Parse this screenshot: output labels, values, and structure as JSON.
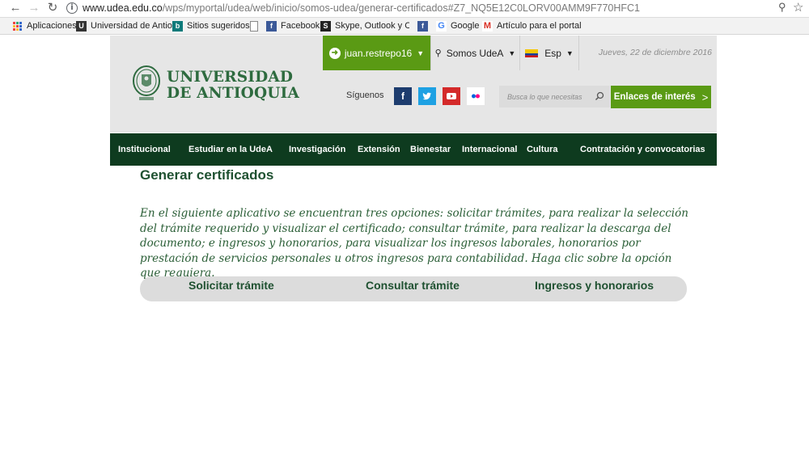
{
  "browser": {
    "url_domain": "www.udea.edu.co",
    "url_path": "/wps/myportal/udea/web/inicio/somos-udea/generar-certificados#Z7_NQ5E12C0LORV00AMM9F770HFC1",
    "bookmarks": [
      "Aplicaciones",
      "Universidad de Antioc",
      "Sitios sugeridos",
      "",
      "Facebook",
      "Skype, Outlook y Cale",
      "",
      "Google",
      "Artículo para el portal"
    ]
  },
  "header": {
    "logo_line1": "UNIVERSIDAD",
    "logo_line2": "DE ANTIOQUIA",
    "user_label": "juan.restrepo16",
    "somos_label": "Somos UdeA",
    "lang_label": "Esp",
    "date_text": "Jueves, 22 de diciembre 2016",
    "siguenos_label": "Síguenos",
    "search_placeholder": "Busca lo que necesitas",
    "enlaces_label": "Enlaces de interés",
    "social": [
      {
        "name": "facebook",
        "glyph": "f",
        "color": "#1d3c6e"
      },
      {
        "name": "twitter",
        "glyph": "t",
        "color": "#1ea1e3"
      },
      {
        "name": "youtube",
        "glyph": "▶",
        "color": "#d42a2a"
      },
      {
        "name": "flickr",
        "glyph": "●●",
        "color": "#ffffff"
      }
    ]
  },
  "nav": {
    "items": [
      "Institucional",
      "Estudiar en la UdeA",
      "Investigación",
      "Extensión",
      "Bienestar",
      "Internacional",
      "Cultura",
      "Contratación y convocatorias"
    ]
  },
  "content": {
    "title": "Generar certificados",
    "intro": "En el siguiente aplicativo se encuentran tres opciones: solicitar trámites, para realizar la selección del trámite requerido y visualizar el certificado; consultar trámite, para realizar la descarga del documento; e ingresos y honorarios, para visualizar los ingresos laborales, honorarios por prestación de servicios personales u otros ingresos para contabilidad. Haga clic sobre la opción que requiera.",
    "options": [
      "Solicitar trámite",
      "Consultar trámite",
      "Ingresos y honorarios"
    ]
  },
  "colors": {
    "green_accent": "#5a9a14",
    "nav_dark": "#0e3b1f",
    "title_green": "#1f5131",
    "header_gray": "#e6e6e6"
  }
}
